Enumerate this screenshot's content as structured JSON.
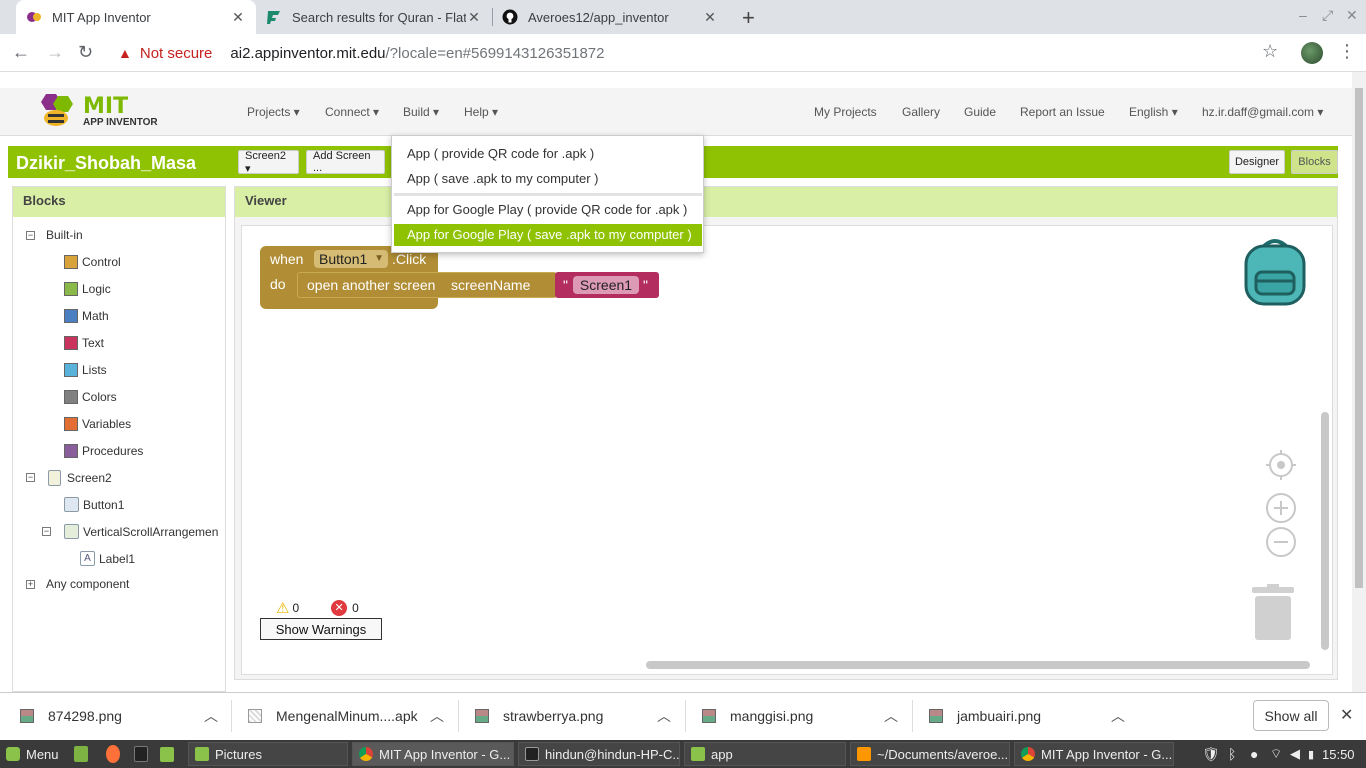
{
  "browser": {
    "tabs": [
      {
        "title": "MIT App Inventor",
        "close": "✕"
      },
      {
        "title": "Search results for Quran - Flatic",
        "close": "✕"
      },
      {
        "title": "Averoes12/app_inventor",
        "close": "✕"
      }
    ],
    "new_tab": "+",
    "security_label": "Not secure",
    "url_host": "ai2.appinventor.mit.edu",
    "url_path": "/?locale=en#5699143126351872"
  },
  "app": {
    "logo_mit": "MIT",
    "logo_sub": "APP INVENTOR",
    "menu_left": [
      "Projects ▾",
      "Connect ▾",
      "Build ▾",
      "Help ▾"
    ],
    "menu_right": [
      "My Projects",
      "Gallery",
      "Guide",
      "Report an Issue",
      "English ▾",
      "hz.ir.daff@gmail.com ▾"
    ],
    "project_name": "Dzikir_Shobah_Masa",
    "screen_selector": "Screen2 ▾",
    "add_screen": "Add Screen ...",
    "designer_btn": "Designer",
    "blocks_btn": "Blocks"
  },
  "build_menu": {
    "items": [
      "App ( provide QR code for .apk )",
      "App ( save .apk to my computer )",
      "App for Google Play ( provide QR code for .apk )",
      "App for Google Play ( save .apk to my computer )"
    ],
    "selected_index": 3
  },
  "blocks_panel": {
    "title": "Blocks",
    "builtin_label": "Built-in",
    "builtin": [
      {
        "label": "Control",
        "color": "#d9a33c"
      },
      {
        "label": "Logic",
        "color": "#8ab94a"
      },
      {
        "label": "Math",
        "color": "#4a7fc1"
      },
      {
        "label": "Text",
        "color": "#c8345e"
      },
      {
        "label": "Lists",
        "color": "#58b2da"
      },
      {
        "label": "Colors",
        "color": "#808080"
      },
      {
        "label": "Variables",
        "color": "#e26e33"
      },
      {
        "label": "Procedures",
        "color": "#8a5e9a"
      }
    ],
    "screen": "Screen2",
    "button": "Button1",
    "arrangement": "VerticalScrollArrangemen",
    "label": "Label1",
    "any_component": "Any component"
  },
  "viewer": {
    "title": "Viewer",
    "event_when": "when",
    "event_component": "Button1",
    "event_name": ".Click",
    "event_do": "do",
    "call_label": "open another screen",
    "param_label": "screenName",
    "quote_open": "\"",
    "string_value": "Screen1",
    "quote_close": "\"",
    "warnings_count": "0",
    "errors_count": "0",
    "show_warnings": "Show Warnings"
  },
  "downloads": {
    "items": [
      "874298.png",
      "MengenalMinum....apk",
      "strawberrya.png",
      "manggisi.png",
      "jambuairi.png"
    ],
    "show_all": "Show all"
  },
  "taskbar": {
    "menu": "Menu",
    "items": [
      "Pictures",
      "MIT App Inventor - G...",
      "hindun@hindun-HP-C...",
      "app",
      "~/Documents/averoe...",
      "MIT App Inventor - G..."
    ],
    "time": "15:50"
  }
}
